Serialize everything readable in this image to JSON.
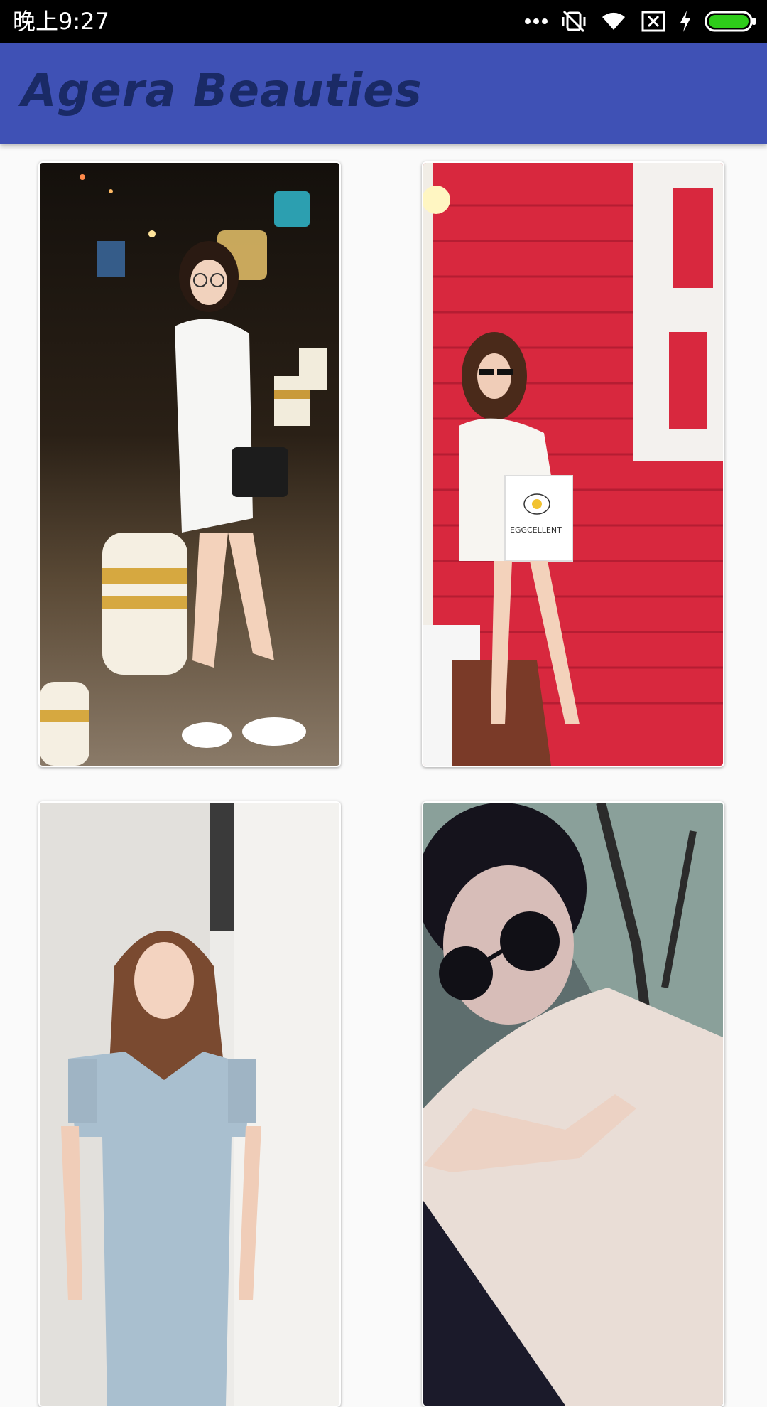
{
  "status_bar": {
    "time": "晚上9:27",
    "icons": [
      "more-dots-icon",
      "vibrate-off-icon",
      "wifi-icon",
      "no-sim-icon",
      "charging-bolt-icon",
      "battery-icon"
    ],
    "battery_color": "#2ecc1a"
  },
  "app_bar": {
    "title": "Agera Beauties",
    "color": "#3f51b5",
    "title_color": "#1a2a66"
  },
  "gallery": {
    "items": [
      {
        "name": "photo-night-street-girl-white-sweater"
      },
      {
        "name": "photo-red-wall-girl-white-dress",
        "bag_text": "EGGCELLENT"
      },
      {
        "name": "photo-girl-blue-dress"
      },
      {
        "name": "photo-girl-sunglasses-selfie"
      }
    ]
  }
}
